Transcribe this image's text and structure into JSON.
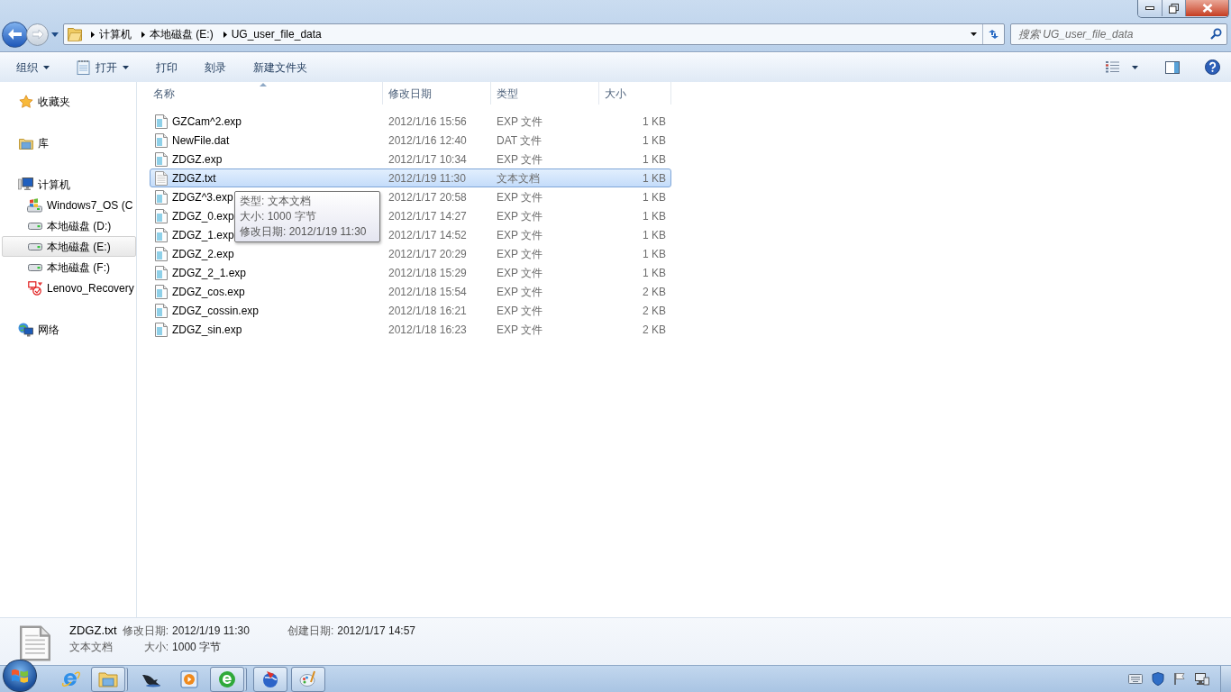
{
  "address_bar": {
    "breadcrumbs": [
      "计算机",
      "本地磁盘 (E:)",
      "UG_user_file_data"
    ]
  },
  "search": {
    "placeholder": "搜索 UG_user_file_data"
  },
  "toolbar": {
    "buttons": [
      {
        "label": "组织",
        "dropdown": true
      },
      {
        "label": "打开",
        "dropdown": true
      },
      {
        "label": "打印",
        "dropdown": false
      },
      {
        "label": "刻录",
        "dropdown": false
      },
      {
        "label": "新建文件夹",
        "dropdown": false
      }
    ]
  },
  "sidebar": {
    "groups": [
      {
        "kind": "favorites",
        "label": "收藏夹",
        "selected": false
      },
      {
        "kind": "library",
        "label": "库",
        "selected": false
      },
      {
        "kind": "computer",
        "label": "计算机",
        "selected": false,
        "children": [
          {
            "kind": "system",
            "label": "Windows7_OS (C",
            "selected": false
          },
          {
            "kind": "drive",
            "label": "本地磁盘 (D:)",
            "selected": false
          },
          {
            "kind": "drive",
            "label": "本地磁盘 (E:)",
            "selected": true
          },
          {
            "kind": "drive",
            "label": "本地磁盘 (F:)",
            "selected": false
          },
          {
            "kind": "recovery",
            "label": "Lenovo_Recovery",
            "selected": false
          }
        ]
      },
      {
        "kind": "network",
        "label": "网络",
        "selected": false
      }
    ]
  },
  "file_list": {
    "columns": [
      {
        "label": "名称",
        "sorted": true
      },
      {
        "label": "修改日期",
        "sorted": false
      },
      {
        "label": "类型",
        "sorted": false
      },
      {
        "label": "大小",
        "sorted": false
      }
    ],
    "rows": [
      {
        "kind": "file",
        "name": "GZCam^2.exp",
        "modified": "2012/1/16 15:56",
        "type": "EXP 文件",
        "size": "1 KB",
        "selected": false
      },
      {
        "kind": "file",
        "name": "NewFile.dat",
        "modified": "2012/1/16 12:40",
        "type": "DAT 文件",
        "size": "1 KB",
        "selected": false
      },
      {
        "kind": "file",
        "name": "ZDGZ.exp",
        "modified": "2012/1/17 10:34",
        "type": "EXP 文件",
        "size": "1 KB",
        "selected": false
      },
      {
        "kind": "text",
        "name": "ZDGZ.txt",
        "modified": "2012/1/19 11:30",
        "type": "文本文档",
        "size": "1 KB",
        "selected": true
      },
      {
        "kind": "file",
        "name": "ZDGZ^3.exp",
        "modified": "2012/1/17 20:58",
        "type": "EXP 文件",
        "size": "1 KB",
        "selected": false
      },
      {
        "kind": "file",
        "name": "ZDGZ_0.exp",
        "modified": "2012/1/17 14:27",
        "type": "EXP 文件",
        "size": "1 KB",
        "selected": false
      },
      {
        "kind": "file",
        "name": "ZDGZ_1.exp",
        "modified": "2012/1/17 14:52",
        "type": "EXP 文件",
        "size": "1 KB",
        "selected": false
      },
      {
        "kind": "file",
        "name": "ZDGZ_2.exp",
        "modified": "2012/1/17 20:29",
        "type": "EXP 文件",
        "size": "1 KB",
        "selected": false
      },
      {
        "kind": "file",
        "name": "ZDGZ_2_1.exp",
        "modified": "2012/1/18 15:29",
        "type": "EXP 文件",
        "size": "1 KB",
        "selected": false
      },
      {
        "kind": "file",
        "name": "ZDGZ_cos.exp",
        "modified": "2012/1/18 15:54",
        "type": "EXP 文件",
        "size": "2 KB",
        "selected": false
      },
      {
        "kind": "file",
        "name": "ZDGZ_cossin.exp",
        "modified": "2012/1/18 16:21",
        "type": "EXP 文件",
        "size": "2 KB",
        "selected": false
      },
      {
        "kind": "file",
        "name": "ZDGZ_sin.exp",
        "modified": "2012/1/18 16:23",
        "type": "EXP 文件",
        "size": "2 KB",
        "selected": false
      }
    ]
  },
  "tooltip": {
    "lines": [
      "类型: 文本文档",
      "大小: 1000 字节",
      "修改日期: 2012/1/19 11:30"
    ]
  },
  "details_pane": {
    "name": "ZDGZ.txt",
    "type": "文本文档",
    "field_groups": [
      {
        "fields": [
          {
            "label": "修改日期:",
            "value": "2012/1/19 11:30"
          },
          {
            "label": "大小:",
            "value": "1000 字节"
          }
        ]
      },
      {
        "fields": [
          {
            "label": "创建日期:",
            "value": "2012/1/17 14:57"
          }
        ]
      }
    ]
  },
  "taskbar": {
    "apps": [
      {
        "kind": "browser",
        "running": false,
        "grouped": false
      },
      {
        "kind": "folder",
        "running": true,
        "grouped": true
      },
      {
        "kind": "bird",
        "running": false,
        "grouped": false
      },
      {
        "kind": "player",
        "running": false,
        "grouped": false
      },
      {
        "kind": "messenger",
        "running": true,
        "grouped": true
      },
      {
        "kind": "globe",
        "running": true,
        "grouped": false
      },
      {
        "kind": "paint",
        "running": true,
        "grouped": false
      }
    ]
  }
}
